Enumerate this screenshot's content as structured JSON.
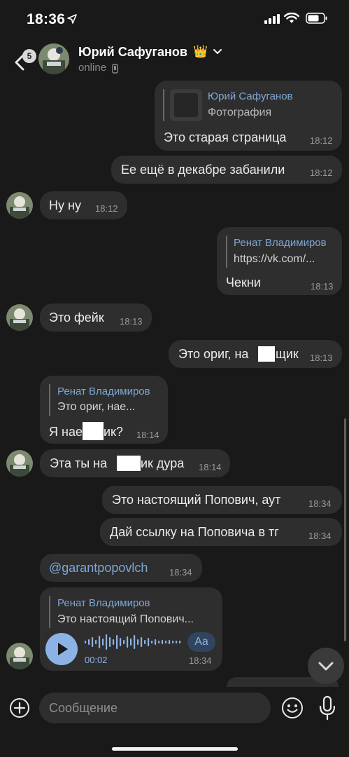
{
  "status_bar": {
    "time": "18:36"
  },
  "header": {
    "unread_count": "5",
    "contact_name": "Юрий Сафуганов",
    "status": "online"
  },
  "messages": [
    {
      "side": "out",
      "reply_name": "Юрий Сафуганов",
      "reply_text": "Фотография",
      "text": "Это старая страница",
      "time": "18:12"
    },
    {
      "side": "out",
      "text": "Ее ещё в декабре забанили",
      "time": "18:12"
    },
    {
      "side": "in",
      "text": "Ну ну",
      "time": "18:12"
    },
    {
      "side": "out",
      "reply_name": "Ренат Владимиров",
      "link": "https://vk.com/...",
      "text": "Чекни",
      "time": "18:13"
    },
    {
      "side": "in",
      "text": "Это фейк",
      "time": "18:13"
    },
    {
      "side": "out",
      "text_a": "Это ориг, на",
      "text_b": "щик",
      "time": "18:13"
    },
    {
      "side": "in",
      "reply_name": "Ренат Владимиров",
      "reply_text": "Это ориг, нае...",
      "text_a": "Я нае",
      "text_b": "ик?",
      "time": "18:14"
    },
    {
      "side": "in",
      "text_a": "Эта ты на",
      "text_b": "ик дура",
      "time": "18:14"
    },
    {
      "side": "out",
      "text": "Это настоящий Попович, аут",
      "time": "18:34"
    },
    {
      "side": "out",
      "text": "Дай ссылку на Поповича в тг",
      "time": "18:34"
    },
    {
      "side": "in",
      "text": "@garantpopovlch",
      "time": "18:34"
    },
    {
      "side": "in",
      "reply_name": "Ренат Владимиров",
      "reply_text": "Это настоящий Попович...",
      "voice_duration": "00:02",
      "transcribe_label": "Aa",
      "time": "18:34"
    }
  ],
  "input": {
    "placeholder": "Сообщение"
  },
  "icons": {
    "back": "chevron-left-icon",
    "crown": "crown-emoji",
    "dropdown": "chevron-down-icon",
    "device": "phone-icon",
    "plus": "plus-icon",
    "emoji": "smiley-icon",
    "mic": "microphone-icon",
    "play": "play-icon",
    "scroll_down": "chevron-down-icon"
  },
  "colors": {
    "background": "#191919",
    "bubble": "#2e2e2e",
    "accent": "#7fa6d6"
  }
}
